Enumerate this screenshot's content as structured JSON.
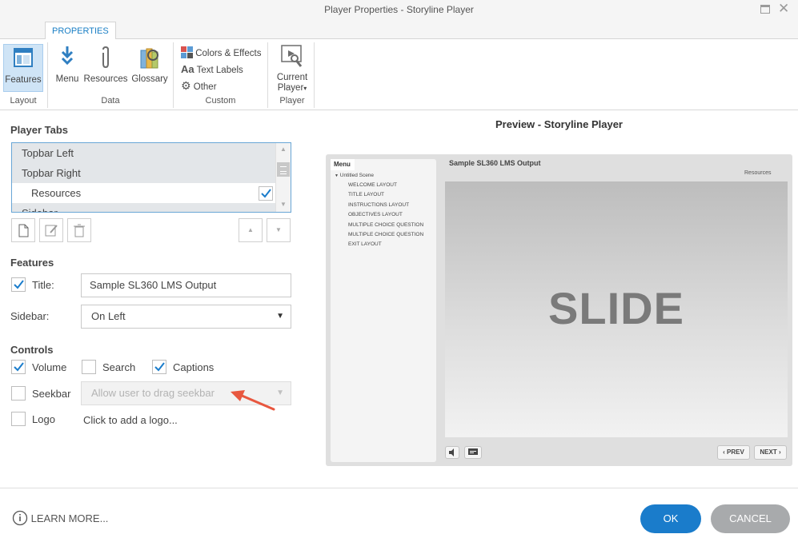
{
  "window": {
    "title": "Player Properties - Storyline Player"
  },
  "ribbon": {
    "tab": "PROPERTIES",
    "groups": {
      "layout": {
        "label": "Layout",
        "features": "Features"
      },
      "data": {
        "label": "Data",
        "menu": "Menu",
        "resources": "Resources",
        "glossary": "Glossary"
      },
      "custom": {
        "label": "Custom",
        "colors": "Colors & Effects",
        "text_labels": "Text Labels",
        "other": "Other"
      },
      "player": {
        "label": "Player",
        "current_line1": "Current",
        "current_line2": "Player"
      }
    }
  },
  "player_tabs": {
    "heading": "Player Tabs",
    "items": [
      {
        "label": "Topbar Left"
      },
      {
        "label": "Topbar Right"
      },
      {
        "label": "Resources"
      },
      {
        "label": "Sidebar"
      }
    ]
  },
  "features": {
    "heading": "Features",
    "title_label": "Title:",
    "title_value": "Sample SL360 LMS Output",
    "sidebar_label": "Sidebar:",
    "sidebar_value": "On Left"
  },
  "controls": {
    "heading": "Controls",
    "volume": "Volume",
    "search": "Search",
    "captions": "Captions",
    "seekbar": "Seekbar",
    "seekbar_option": "Allow user to drag seekbar",
    "logo": "Logo",
    "logo_link": "Click to add a logo..."
  },
  "preview": {
    "heading": "Preview - Storyline Player",
    "menu_tab": "Menu",
    "course_title": "Sample SL360 LMS Output",
    "resources": "Resources",
    "scene": "Untitled Scene",
    "menu_items": [
      "WELCOME LAYOUT",
      "TITLE LAYOUT",
      "INSTRUCTIONS LAYOUT",
      "OBJECTIVES LAYOUT",
      "MULTIPLE CHOICE QUESTION",
      "MULTIPLE CHOICE QUESTION",
      "EXIT LAYOUT"
    ],
    "slide_text": "SLIDE",
    "prev": "PREV",
    "next": "NEXT"
  },
  "footer": {
    "learn_more": "LEARN MORE...",
    "ok": "OK",
    "cancel": "CANCEL"
  },
  "colors": {
    "accent": "#1a7ccb",
    "annotation_arrow": "#e8573f"
  }
}
